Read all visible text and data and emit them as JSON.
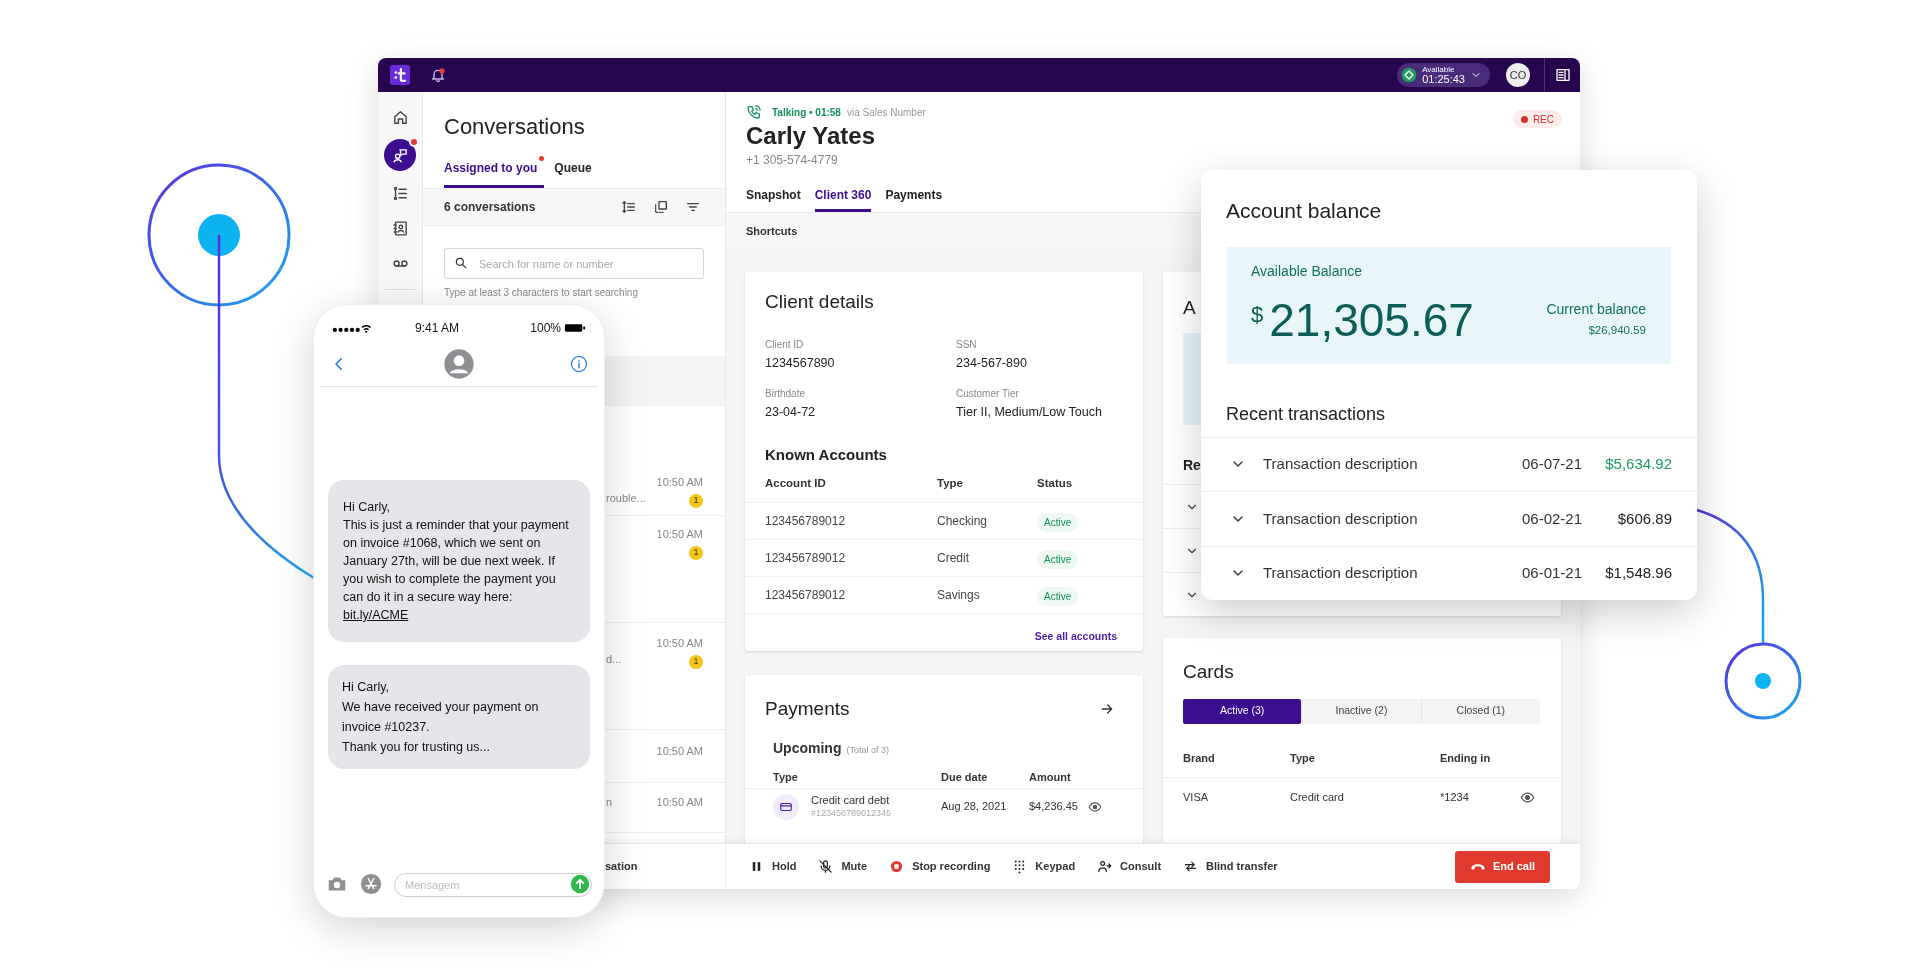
{
  "top_bar": {
    "status": {
      "label": "Available",
      "timer": "01:25:43"
    },
    "avatar": "CO"
  },
  "sidebar": {
    "items": [
      {
        "kind": "home",
        "selected": false,
        "notification": false
      },
      {
        "kind": "conversations",
        "selected": true,
        "notification": true
      },
      {
        "kind": "list",
        "selected": false,
        "notification": false
      },
      {
        "kind": "contacts",
        "selected": false,
        "notification": false
      },
      {
        "kind": "voicemail",
        "selected": false,
        "notification": false
      }
    ]
  },
  "conversations": {
    "title": "Conversations",
    "tabs": [
      {
        "label": "Assigned to you",
        "selected": true,
        "unread": true
      },
      {
        "label": "Queue",
        "selected": false,
        "unread": false
      }
    ],
    "count": "6 conversations",
    "search": {
      "placeholder": "Search for name or number",
      "hint": "Type at least 3 characters to start searching"
    },
    "rows": [
      {
        "selected": true
      },
      {
        "selected": false,
        "snippet": "rouble...",
        "time": "10:50 AM",
        "unread": "1"
      },
      {
        "selected": false,
        "time": "10:50 AM",
        "unread": "1"
      },
      {
        "selected": false,
        "snippet": "d...",
        "time": "10:50 AM",
        "unread": "1"
      },
      {
        "selected": false,
        "time": "10:50 AM"
      },
      {
        "selected": false,
        "snippet": "n",
        "time": "10:50 AM"
      }
    ]
  },
  "call": {
    "status": "Talking • 01:58",
    "via": "via Sales Number",
    "recording": "REC",
    "name": "Carly Yates",
    "phone": "+1 305-574-4779",
    "tabs": [
      {
        "label": "Snapshot",
        "selected": false
      },
      {
        "label": "Client 360",
        "selected": true
      },
      {
        "label": "Payments",
        "selected": false
      }
    ],
    "shortcuts": "Shortcuts"
  },
  "client_details": {
    "title": "Client details",
    "fields": [
      {
        "label": "Client ID",
        "value": "1234567890"
      },
      {
        "label": "SSN",
        "value": "234-567-890"
      },
      {
        "label": "Birthdate",
        "value": "23-04-72"
      },
      {
        "label": "Customer Tier",
        "value": "Tier II, Medium/Low Touch"
      }
    ],
    "accounts_title": "Known Accounts",
    "columns": [
      "Account ID",
      "Type",
      "Status"
    ],
    "rows": [
      {
        "id": "123456789012",
        "type": "Checking",
        "status": "Active"
      },
      {
        "id": "123456789012",
        "type": "Credit",
        "status": "Active"
      },
      {
        "id": "123456789012",
        "type": "Savings",
        "status": "Active"
      }
    ],
    "link": "See all accounts"
  },
  "account_panel_behind": {
    "title": "A",
    "section": "Re"
  },
  "payments": {
    "title": "Payments",
    "subtitle": "Upcoming",
    "total": "(Total of 3)",
    "columns": [
      "Type",
      "Due date",
      "Amount"
    ],
    "rows": [
      {
        "name": "Credit card debt",
        "number": "#123456789012345",
        "due": "Aug 28, 2021",
        "amount": "$4,236.45"
      }
    ]
  },
  "cards": {
    "title": "Cards",
    "tabs": [
      {
        "label": "Active (3)",
        "selected": true
      },
      {
        "label": "Inactive (2)",
        "selected": false
      },
      {
        "label": "Closed (1)",
        "selected": false
      }
    ],
    "columns": [
      "Brand",
      "Type",
      "Ending in"
    ],
    "rows": [
      {
        "brand": "VISA",
        "type": "Credit card",
        "ending": "*1234"
      }
    ]
  },
  "call_bar": {
    "left_label": "sation",
    "actions": [
      {
        "kind": "hold",
        "label": "Hold"
      },
      {
        "kind": "mute",
        "label": "Mute"
      },
      {
        "kind": "stop_recording",
        "label": "Stop recording"
      },
      {
        "kind": "keypad",
        "label": "Keypad"
      },
      {
        "kind": "consult",
        "label": "Consult"
      },
      {
        "kind": "transfer",
        "label": "Blind transfer"
      }
    ],
    "end_call": "End call"
  },
  "phone": {
    "time": "9:41 AM",
    "battery": "100%",
    "messages": [
      {
        "lines": [
          "Hi Carly,",
          "This is just a reminder that your payment on invoice #1068, which we sent on January 27th, will be due next week. If you wish to complete the payment you can do it in a secure way here:"
        ],
        "link": "bit.ly/ACME"
      },
      {
        "lines": [
          "Hi Carly,",
          "We have received your payment on invoice #10237.",
          "Thank you for trusting us..."
        ]
      }
    ],
    "input_placeholder": "Mensagem"
  },
  "account_balance": {
    "title": "Account balance",
    "available_label": "Available Balance",
    "currency": "$",
    "available": "21,305.67",
    "current_label": "Current balance",
    "current": "$26,940.59",
    "transactions_title": "Recent transactions",
    "transactions": [
      {
        "description": "Transaction description",
        "date": "06-07-21",
        "amount": "$5,634.92",
        "positive": true
      },
      {
        "description": "Transaction description",
        "date": "06-02-21",
        "amount": "$606.89",
        "positive": false
      },
      {
        "description": "Transaction description",
        "date": "06-01-21",
        "amount": "$1,548.96",
        "positive": false
      }
    ]
  }
}
